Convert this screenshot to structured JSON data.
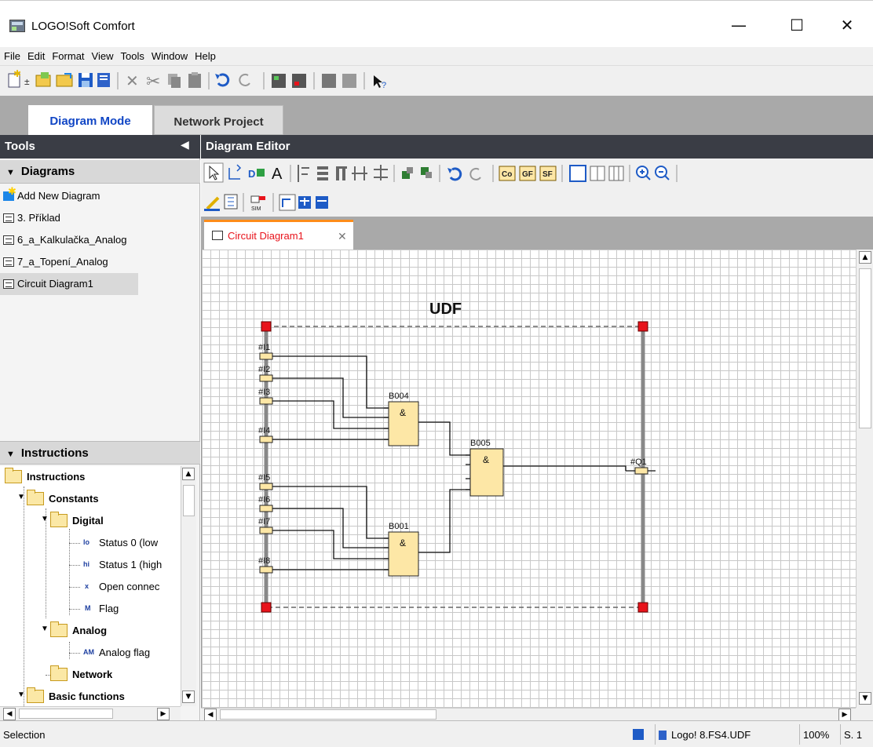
{
  "window": {
    "title": "LOGO!Soft Comfort",
    "minimize": "—",
    "maximize": "☐",
    "close": "✕"
  },
  "menu": [
    "File",
    "Edit",
    "Format",
    "View",
    "Tools",
    "Window",
    "Help"
  ],
  "mode_tabs": {
    "active": "Diagram Mode",
    "inactive": "Network Project"
  },
  "tools_panel": {
    "title": "Tools",
    "diagrams_header": "Diagrams",
    "diagrams": [
      "Add New Diagram",
      "3. Příklad",
      "6_a_Kalkulačka_Analog",
      "7_a_Topení_Analog",
      "Circuit Diagram1"
    ],
    "instructions_header": "Instructions",
    "tree": {
      "root": "Instructions",
      "constants": "Constants",
      "digital": "Digital",
      "digital_items": [
        {
          "badge": "lo",
          "label": "Status 0 (low"
        },
        {
          "badge": "hi",
          "label": "Status 1 (high"
        },
        {
          "badge": "x",
          "label": "Open connec"
        },
        {
          "badge": "M",
          "label": "Flag"
        }
      ],
      "analog": "Analog",
      "analog_items": [
        {
          "badge": "AM",
          "label": "Analog flag"
        }
      ],
      "network": "Network",
      "basic": "Basic functions"
    }
  },
  "editor": {
    "title": "Diagram Editor",
    "tab_label": "Circuit Diagram1",
    "tab_close": "✕",
    "toolbar_text_tool": "A",
    "toolbar_buttons": [
      "Co",
      "GF",
      "SF"
    ]
  },
  "diagram": {
    "title": "UDF",
    "inputs": [
      "#I1",
      "#I2",
      "#I3",
      "#I4",
      "#I5",
      "#I6",
      "#I7",
      "#I8"
    ],
    "output": "#Q1",
    "blocks": [
      {
        "id": "B004",
        "symbol": "&"
      },
      {
        "id": "B005",
        "symbol": "&"
      },
      {
        "id": "B001",
        "symbol": "&"
      }
    ]
  },
  "status": {
    "mode": "Selection",
    "device": "Logo! 8.FS4.UDF",
    "zoom": "100%",
    "page": "S. 1"
  }
}
